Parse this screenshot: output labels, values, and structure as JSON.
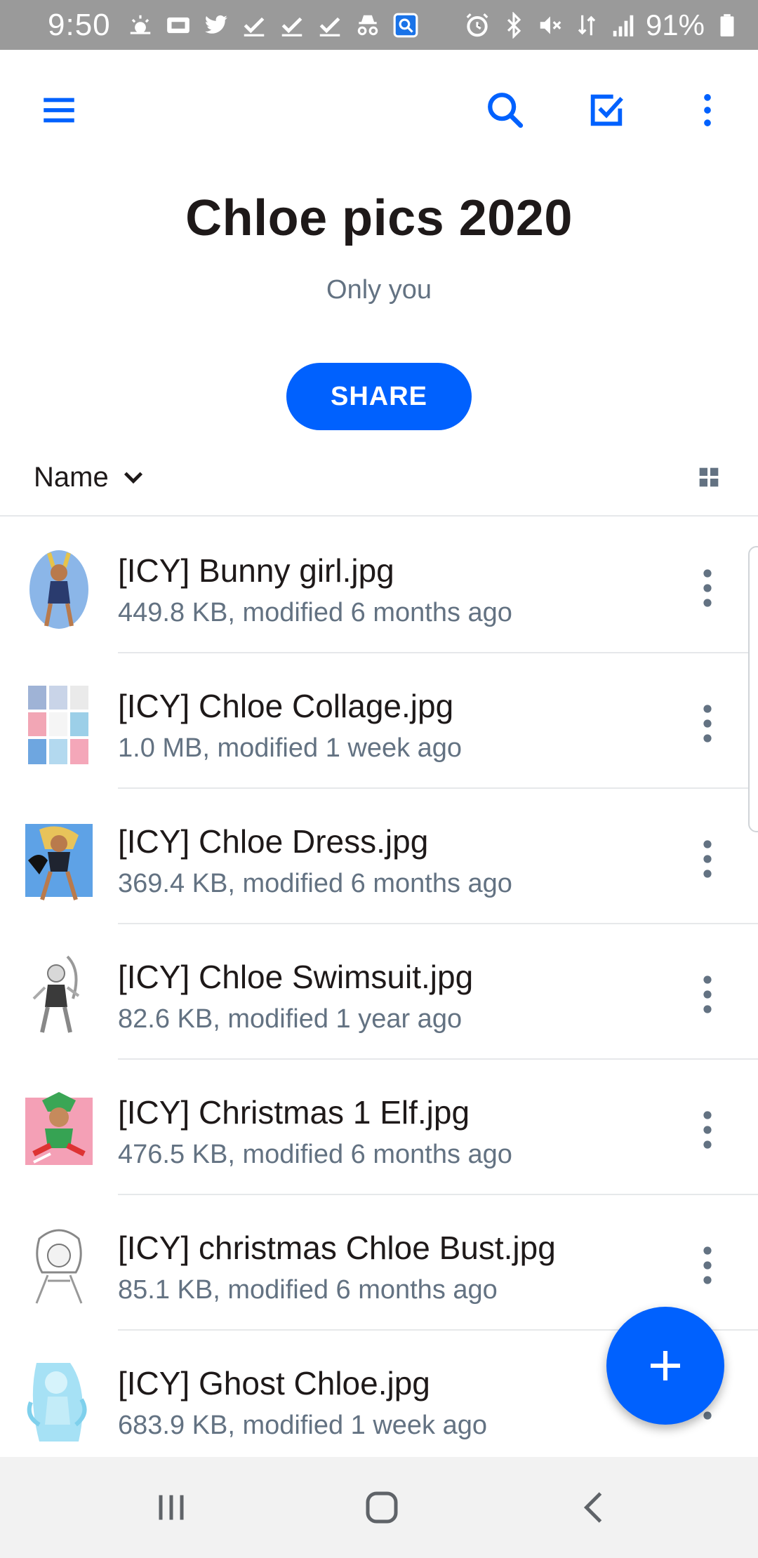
{
  "status_bar": {
    "time": "9:50",
    "battery_percent": "91%",
    "left_icons": [
      "weather-icon",
      "media-icon",
      "twitter-icon",
      "check-icon",
      "check-icon",
      "check-icon",
      "incognito-icon",
      "screen-search-icon"
    ],
    "right_icons": [
      "alarm-icon",
      "bluetooth-icon",
      "mute-icon",
      "data-icon",
      "signal-icon",
      "battery-icon"
    ]
  },
  "toolbar": {
    "icons": [
      "menu-icon",
      "search-icon",
      "select-checkbox-icon",
      "more-vertical-icon"
    ],
    "accent_color": "#0061fe"
  },
  "folder": {
    "title": "Chloe pics 2020",
    "sharing": "Only you",
    "share_label": "SHARE"
  },
  "sort": {
    "label": "Name",
    "view_icon": "grid-view-icon"
  },
  "files": [
    {
      "name": "[ICY] Bunny girl.jpg",
      "meta": "449.8 KB, modified 6 months ago"
    },
    {
      "name": "[ICY] Chloe Collage.jpg",
      "meta": "1.0 MB, modified 1 week ago"
    },
    {
      "name": "[ICY] Chloe Dress.jpg",
      "meta": "369.4 KB, modified 6 months ago"
    },
    {
      "name": "[ICY] Chloe Swimsuit.jpg",
      "meta": "82.6 KB, modified 1 year ago"
    },
    {
      "name": "[ICY] Christmas 1 Elf.jpg",
      "meta": "476.5 KB, modified 6 months ago"
    },
    {
      "name": "[ICY] christmas Chloe Bust.jpg",
      "meta": "85.1 KB, modified 6 months ago"
    },
    {
      "name": "[ICY] Ghost Chloe.jpg",
      "meta": "683.9 KB, modified 1 week ago"
    }
  ],
  "fab": {
    "icon": "plus-icon"
  },
  "nav_bar": {
    "icons": [
      "recent-apps-icon",
      "home-icon",
      "back-icon"
    ]
  }
}
